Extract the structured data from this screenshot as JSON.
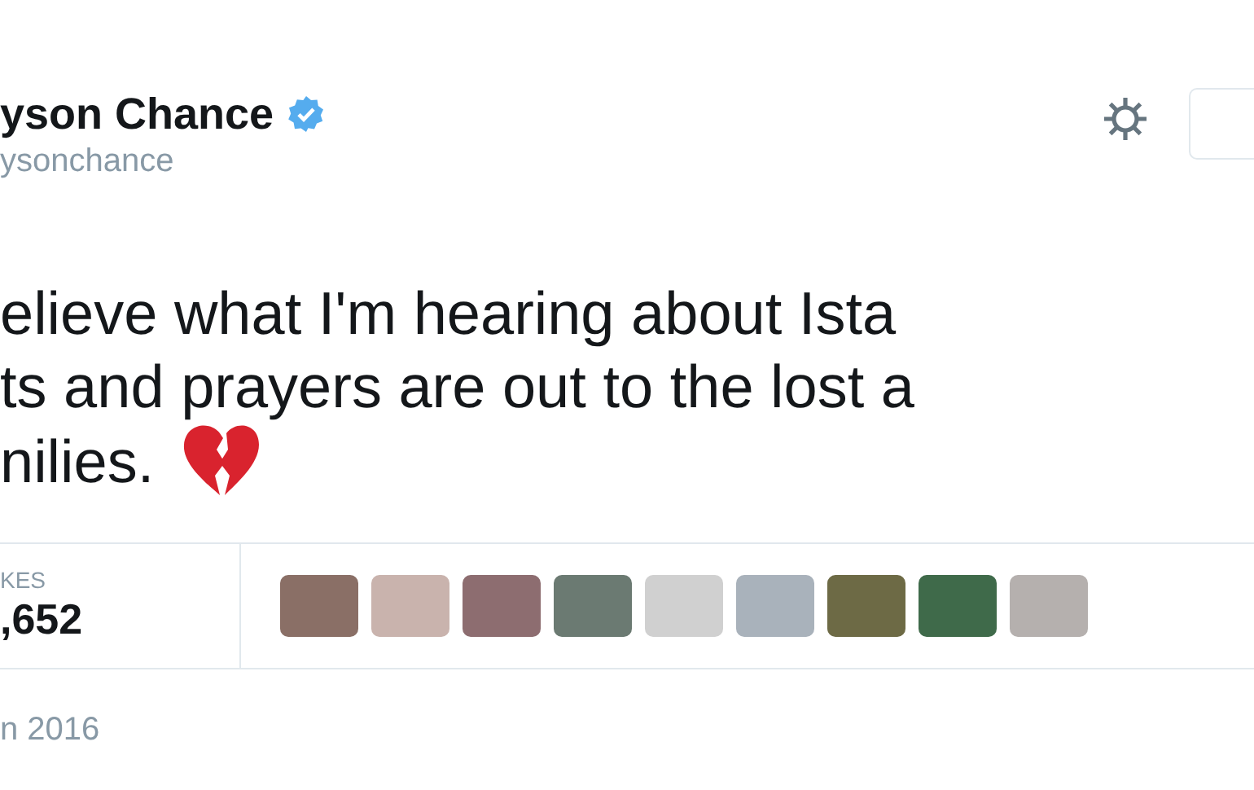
{
  "header": {
    "name": "yson Chance",
    "verified": true,
    "handle": "ysonchance"
  },
  "tweet": {
    "lines": [
      "elieve what I'm hearing about Ista",
      "ts and prayers are out to the lost a",
      "nilies."
    ]
  },
  "stats": {
    "label": "KES",
    "count": ",652"
  },
  "date": "n 2016"
}
